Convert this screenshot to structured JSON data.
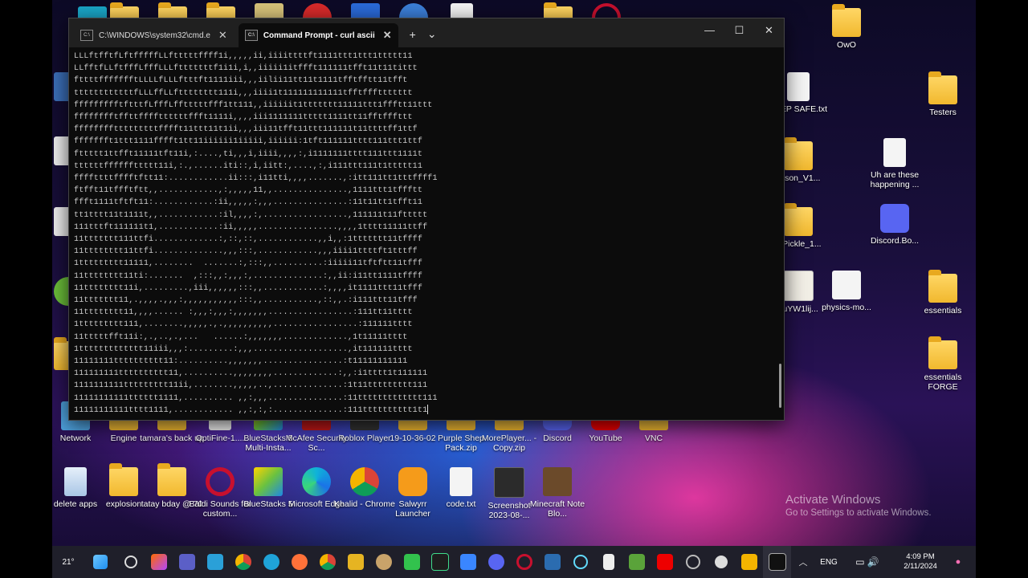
{
  "window": {
    "tabs": [
      {
        "title": "C:\\WINDOWS\\system32\\cmd.e",
        "active": false
      },
      {
        "title": "Command Prompt - curl  ascii",
        "active": true
      }
    ],
    "new_tab_label": "+",
    "dropdown_label": "⌄",
    "minimize": "—",
    "maximize": "☐",
    "close": "✕"
  },
  "terminal_lines": [
    "LLLftfftfLftfffffLLftttttffff1i,,,,,ii,iiiittttft1111ttt1ttt1ttttt11",
    "LLfftfLLftfffLfffLLLftttttttf1i1i,i,,iiiii1itffft111111tfft11t11tittt",
    "fttttffffffftLLLLfLLLftttft1111iii,,,iilii11tt11t1111tfftfftt11tfft",
    "ttttttttttttfLLLffLLftttttttt111i,,,iiii1t111111111111tfftfffttttttt",
    "ffffffffftftttfLfffLfftttttfff1tt111,,iiiiiit1ttttttt11111ttt1ffftt11ttt",
    "fffffffftffttffffttttttffft1111i,,,,iii1111111ttttt1111tt11fftfffttt",
    "fffffffftttttttttfffft11ttt11t1ii,,,iii11tfft11ttt111111t11ttttff1ttf",
    "ffffffft1ttt1111fffft1tt11iiiiii1iiiii,iiiiii:1tft111111tttt111ttt1ttf",
    "fttttt1ttfft11111tft11i,:....,ti,,,i,iiii,,,,:,i1111111tttt111ttt1111t",
    "ttttttffffffttttt11i,:.,......iti::,i,iitt:,....,:,i111ttt111t1ttttt11",
    "ffffttttfffftftt11:............ii:::,i11tti,,,,.......,:itt111tt1tttffff1",
    "ftfft11tffftftt,,............,:,,,,,11,,...............,1111ttt1tffftt",
    "ffft1111tftft11:............:ii,,,,,:,,,...............:11t11tt1tfft11",
    "tt1tttt11t1111t,,............:il,,,,:,.................,111111t11fttttt",
    "111tttft111111t1,............:ii,,,,,................,,,,1tttt11111ttff",
    "11ttttttt111ttfi.............:,::,::,............,,i,,:1ttttttt11tffff",
    "11tttttttt11ttfi..............,,,:::,............,,,iiii1ttttft1tttff",
    "1ttttttttt11111,........  .......:,:::,,..........:iiiii11tftftt11tfff",
    "11tttttttt11ti:.......  ,:::,,:,,,:,..............:,,ii:i11tt1111tffff",
    "11tttttttt11i,.........,iii,,,,,,:::,,............:,,,,it1111ttt11tfff",
    "11ttttttt11,.,,,,.,,,:,,,,,,,,,,,:::,,...........,::,,.:i111ttt11tfff",
    "11tttttttt11,,,,...... :,,,:,,,:,,,,,,,.................:111tt11tttt",
    "1ttttttttt111,........,,,,,.,.,,,,,,,,,,.................:111111tttt",
    "11tttttfft11i:,.,..,.,...   ......:,,,,,,,.............,1t11111tttt",
    "1ttttttttttttt11iii,,,:.........:,,,...................,it111111tttt",
    "11111111tttttttttt11:..........,,,,,,,................:t11111111111",
    "111111111tttttttttt11,..........,,,,,,,,.............:,,:i1tttt1t111111",
    "1111111111ttttttttt11ii,........,,,,,..,..............:1t11ttttttttt111",
    "11111111111tttttt1111,.......... ,,:,,,...............:11ttttttttttttt111",
    "11111111111tttt1111,............ ,,:,:,:..............:111tttttttttt1t1"
  ],
  "desktop_icons": [
    {
      "label": "Network",
      "kind": "pc"
    },
    {
      "label": "Engine",
      "kind": "folder"
    },
    {
      "label": "tamara's back up",
      "kind": "folder"
    },
    {
      "label": "OptiFine-1....",
      "kind": "file"
    },
    {
      "label": "BlueStacks 5 Multi-Insta...",
      "kind": "stack"
    },
    {
      "label": "McAfee Security Sc...",
      "kind": "red"
    },
    {
      "label": "Roblox Player",
      "kind": "dark"
    },
    {
      "label": "19-10-36-02",
      "kind": "folder"
    },
    {
      "label": "Purple Shep Pack.zip",
      "kind": "folder"
    },
    {
      "label": "MorePlayer... - Copy.zip",
      "kind": "folder"
    },
    {
      "label": "Discord",
      "kind": "discord"
    },
    {
      "label": "YouTube",
      "kind": "red"
    },
    {
      "label": "VNC",
      "kind": "folder"
    },
    {
      "label": "delete apps",
      "kind": "bin"
    },
    {
      "label": "explosion",
      "kind": "folder"
    },
    {
      "label": "tatay bday @ 70",
      "kind": "folder"
    },
    {
      "label": "Baldi Sounds for custom...",
      "kind": "opera"
    },
    {
      "label": "BlueStacks 5",
      "kind": "stack"
    },
    {
      "label": "Microsoft Edge",
      "kind": "edge"
    },
    {
      "label": "Khalid - Chrome",
      "kind": "chrome"
    },
    {
      "label": "Salwyrr Launcher",
      "kind": "orange"
    },
    {
      "label": "code.txt",
      "kind": "file"
    },
    {
      "label": "Screenshot 2023-08-...",
      "kind": "dark"
    },
    {
      "label": "Minecraft Note Blo...",
      "kind": "mc"
    },
    {
      "label": "OwO",
      "kind": "folder"
    },
    {
      "label": "KEEP SAFE.txt",
      "kind": "file"
    },
    {
      "label": "Testers",
      "kind": "folder"
    },
    {
      "label": "ckson_V1...",
      "kind": "zip"
    },
    {
      "label": "Uh are these happening ...",
      "kind": "file"
    },
    {
      "label": "MPickle_1...",
      "kind": "zip"
    },
    {
      "label": "Discord.Bo...",
      "kind": "discord"
    },
    {
      "label": "JuYW1lij...",
      "kind": "cert"
    },
    {
      "label": "physics-mo...",
      "kind": "java"
    },
    {
      "label": "essentials",
      "kind": "folder"
    },
    {
      "label": "essentials FORGE",
      "kind": "folder"
    }
  ],
  "watermark": {
    "line1": "Activate Windows",
    "line2": "Go to Settings to activate Windows."
  },
  "taskbar": {
    "weather": "21°",
    "language": "ENG",
    "time": "4:09 PM",
    "date": "2/11/2024"
  },
  "colors": {
    "terminal_bg": "#0c0c0c",
    "terminal_text": "#cccccc",
    "titlebar": "#202020",
    "taskbar": "#1f1f2a"
  }
}
